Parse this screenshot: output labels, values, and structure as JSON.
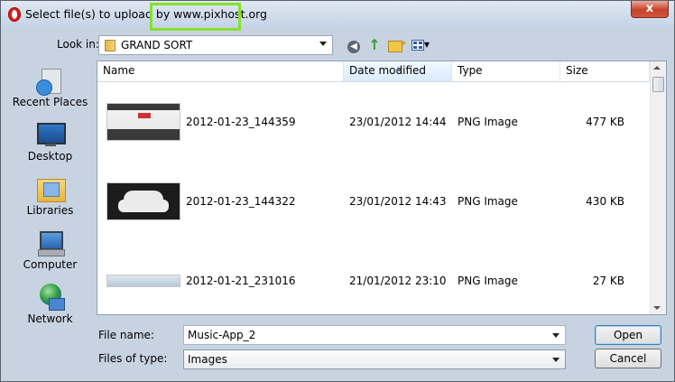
{
  "window": {
    "title": "Select file(s) to upload by www.pixhost.org",
    "close_label": "x"
  },
  "toolbar": {
    "lookin_label": "Look in:",
    "lookin_value": "GRAND SORT",
    "icons": [
      "back-icon",
      "up-folder-icon",
      "new-folder-icon",
      "views-menu-icon"
    ]
  },
  "places": [
    {
      "label": "Recent Places",
      "icon": "recent-places-icon"
    },
    {
      "label": "Desktop",
      "icon": "desktop-icon"
    },
    {
      "label": "Libraries",
      "icon": "libraries-icon"
    },
    {
      "label": "Computer",
      "icon": "computer-icon"
    },
    {
      "label": "Network",
      "icon": "network-icon"
    }
  ],
  "filelist": {
    "columns": [
      "Name",
      "Date modified",
      "Type",
      "Size"
    ],
    "sorted_column": "Date modified",
    "rows": [
      {
        "name": "2012-01-23_144359",
        "date": "23/01/2012 14:44",
        "type": "PNG Image",
        "size": "477 KB"
      },
      {
        "name": "2012-01-23_144322",
        "date": "23/01/2012 14:43",
        "type": "PNG Image",
        "size": "430 KB"
      },
      {
        "name": "2012-01-21_231016",
        "date": "21/01/2012 23:10",
        "type": "PNG Image",
        "size": "27 KB"
      }
    ]
  },
  "bottom": {
    "filename_label": "File name:",
    "filename_value": "Music-App_2",
    "filetype_label": "Files of type:",
    "filetype_value": "Images",
    "open_label": "Open",
    "cancel_label": "Cancel"
  },
  "colors": {
    "title_highlight": "#84e12c",
    "window_frame": "#c8d3e2",
    "close_button": "#c7422d"
  }
}
